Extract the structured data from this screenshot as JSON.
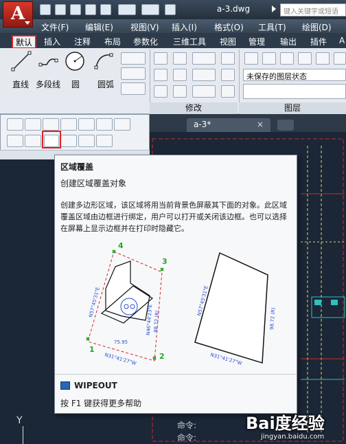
{
  "app": {
    "logo_letter": "A",
    "document_title": "a-3.dwg",
    "search_placeholder": "键入关键字或短语"
  },
  "menu": [
    "文件(F)",
    "编辑(E)",
    "视图(V)",
    "插入(I)",
    "格式(O)",
    "工具(T)",
    "绘图(D)"
  ],
  "ribbon_tabs": [
    "默认",
    "插入",
    "注释",
    "布局",
    "参数化",
    "三维工具",
    "视图",
    "管理",
    "输出",
    "插件",
    "A"
  ],
  "draw_tools": [
    "直线",
    "多段线",
    "圆",
    "圆弧"
  ],
  "panels": {
    "modify": "修改",
    "layer": "图层",
    "layer_state": "未保存的图层状态"
  },
  "file_tab": {
    "name": "a-3*",
    "close": "×"
  },
  "tooltip": {
    "title": "区域覆盖",
    "subtitle": "创建区域覆盖对象",
    "description": "创建多边形区域，该区域将用当前背景色屏蔽其下面的对象。此区域覆盖区域由边框进行绑定，用户可以打开或关闭该边框。也可以选择在屏幕上显示边框并在打印时隐藏它。",
    "command": "WIPEOUT",
    "help": "按 F1 键获得更多帮助",
    "diagram": {
      "points": [
        "1",
        "2",
        "3",
        "4"
      ],
      "dim_left": "N57°45'31\"E",
      "dim_bottom": "N31°41'27\"W",
      "dim_right_a": "N46°44'23\"E",
      "dim_right_b": "98.72 (R)",
      "dim_length": "75.95",
      "dim_left_b": "N57°45'31\"E",
      "dim_bottom_b": "N31°41'27\"W",
      "dim_right_c": "98.72 (R)"
    }
  },
  "command_lines": [
    "命令:",
    "命令:"
  ],
  "axis_label": "Y",
  "watermark": {
    "logo": "Bai度经验",
    "url": "jingyan.baidu.com"
  },
  "colors": {
    "highlight": "#e02020",
    "canvas": "#1b2636",
    "point_marker": "#2aa32a"
  }
}
